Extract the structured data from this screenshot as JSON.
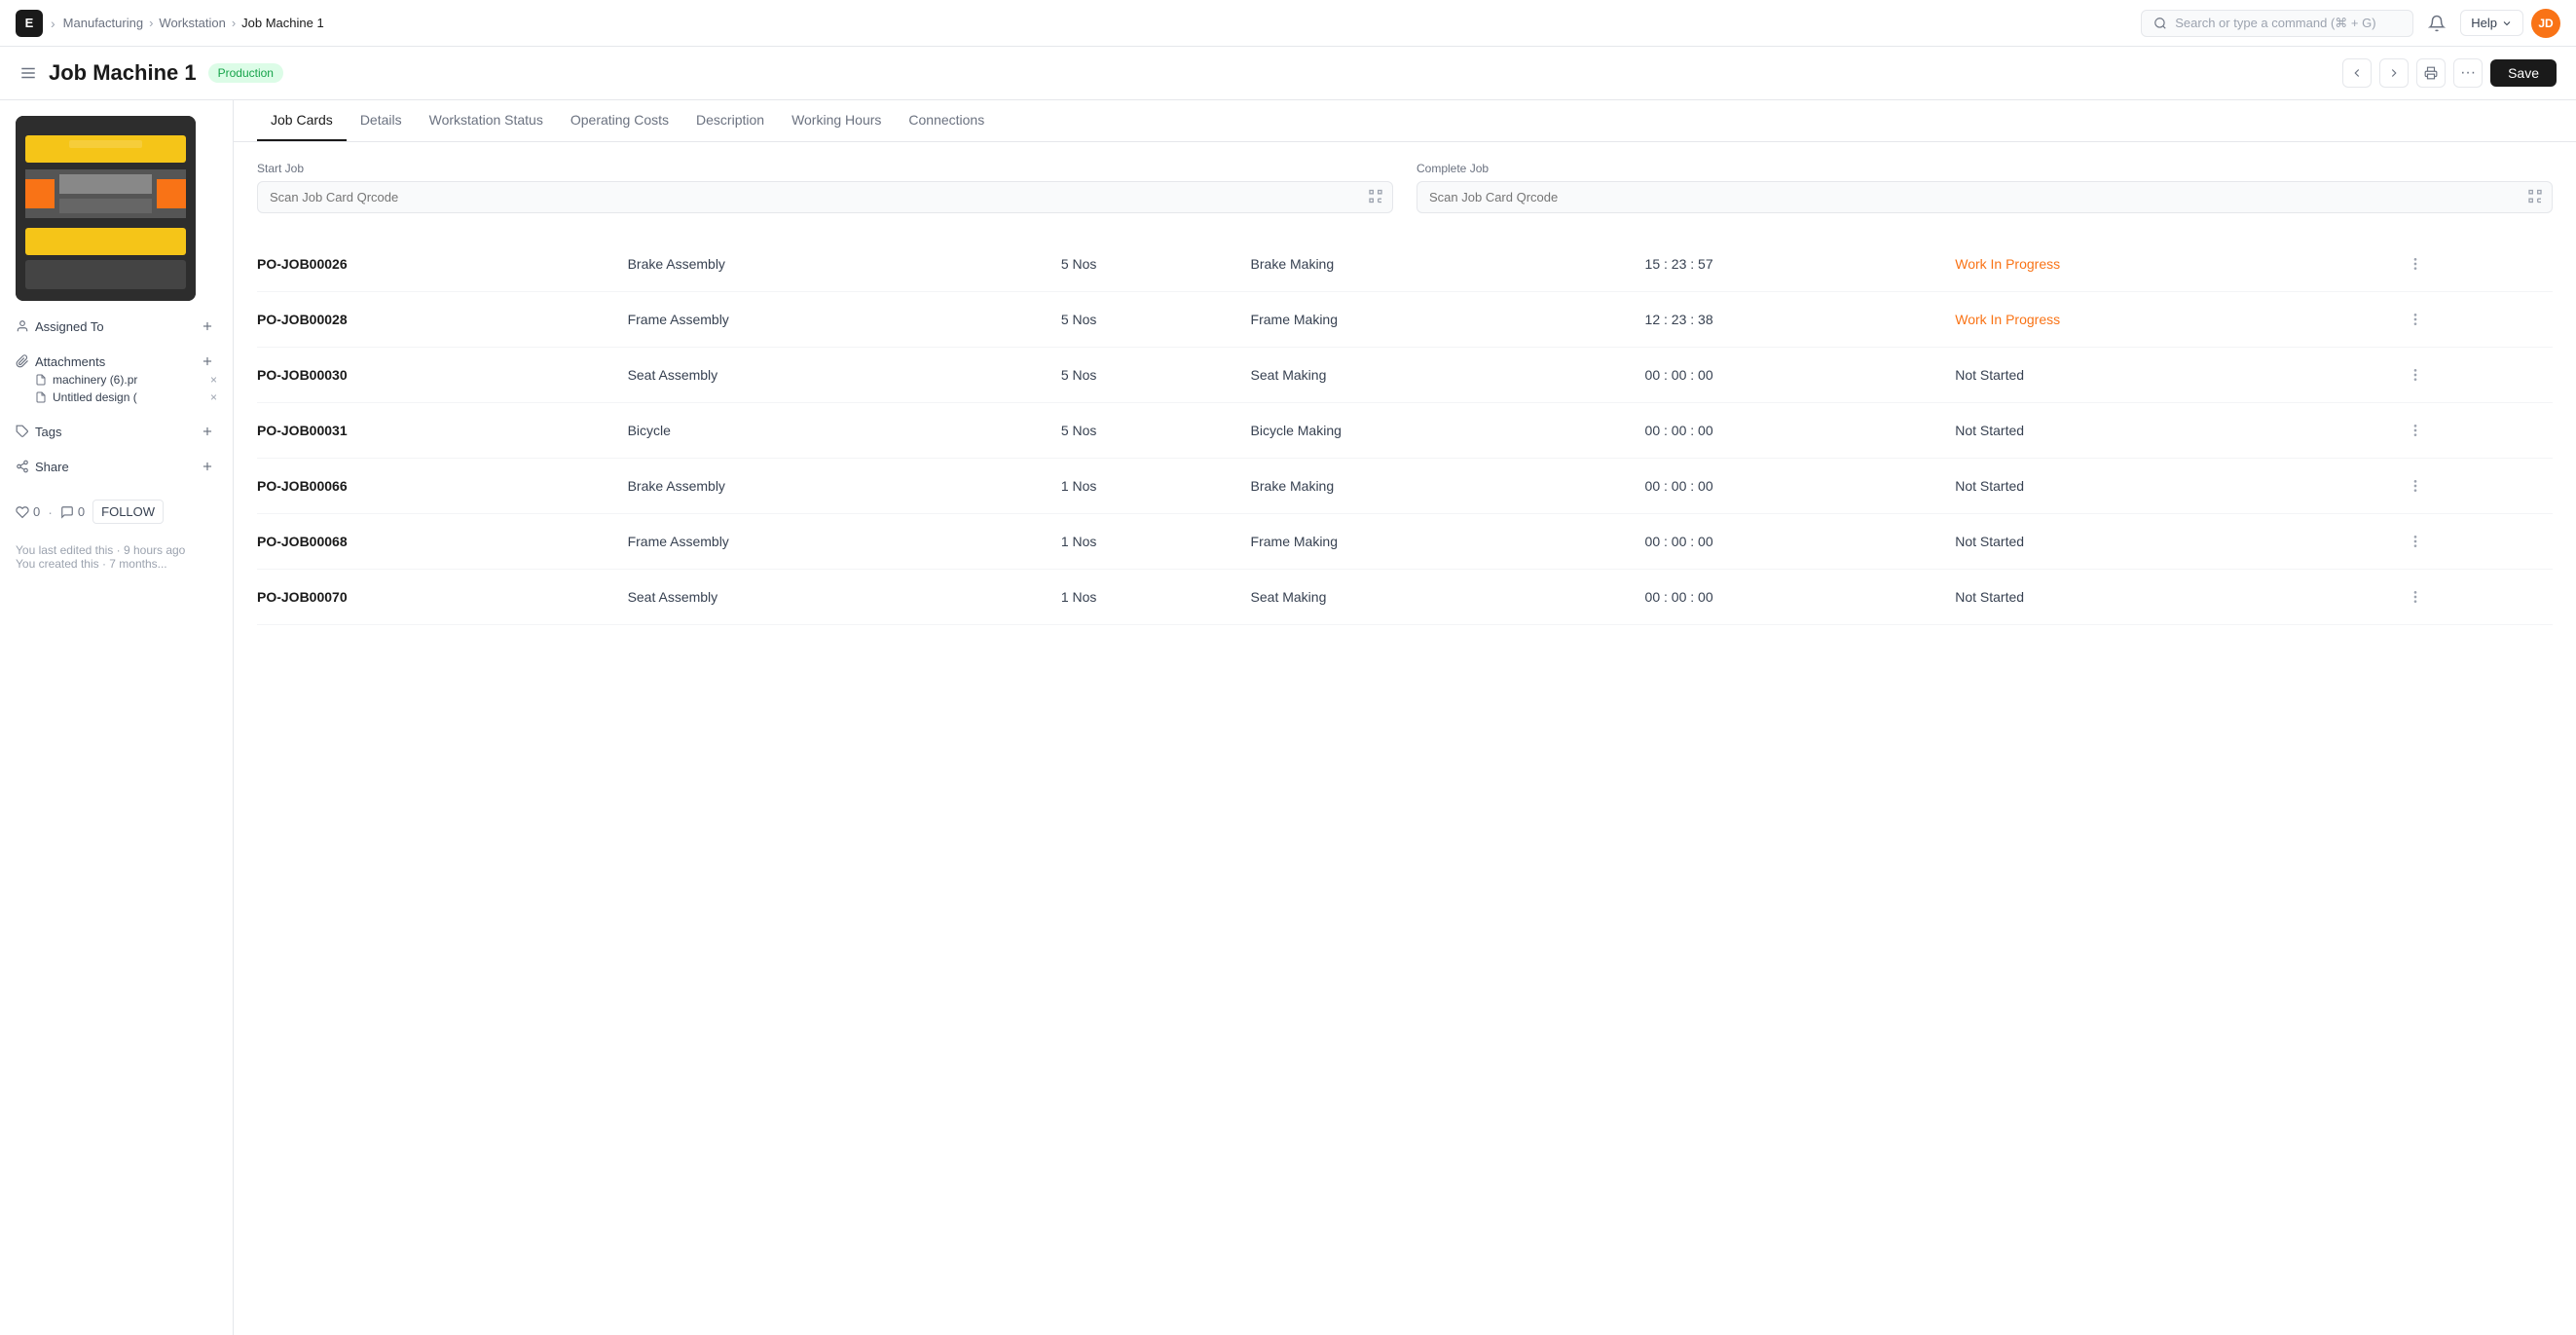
{
  "nav": {
    "logo": "E",
    "breadcrumbs": [
      "Manufacturing",
      "Workstation",
      "Job Machine 1"
    ],
    "search_placeholder": "Search or type a command (⌘ + G)",
    "help_label": "Help",
    "avatar_initials": "JD"
  },
  "header": {
    "title": "Job Machine 1",
    "status": "Production",
    "save_label": "Save"
  },
  "sidebar": {
    "assigned_to_label": "Assigned To",
    "attachments_label": "Attachments",
    "attachment_items": [
      {
        "name": "machinery (6).pr"
      },
      {
        "name": "Untitled design ("
      }
    ],
    "tags_label": "Tags",
    "share_label": "Share",
    "likes_count": "0",
    "comments_count": "0",
    "follow_label": "FOLLOW",
    "last_edited": "You last edited this · 9 hours ago",
    "created_note": "You created this · 7 months..."
  },
  "tabs": [
    {
      "id": "job-cards",
      "label": "Job Cards",
      "active": true
    },
    {
      "id": "details",
      "label": "Details",
      "active": false
    },
    {
      "id": "workstation-status",
      "label": "Workstation Status",
      "active": false
    },
    {
      "id": "operating-costs",
      "label": "Operating Costs",
      "active": false
    },
    {
      "id": "description",
      "label": "Description",
      "active": false
    },
    {
      "id": "working-hours",
      "label": "Working Hours",
      "active": false
    },
    {
      "id": "connections",
      "label": "Connections",
      "active": false
    }
  ],
  "job_cards": {
    "start_job_label": "Start Job",
    "complete_job_label": "Complete Job",
    "scan_placeholder": "Scan Job Card Qrcode",
    "rows": [
      {
        "id": "PO-JOB00026",
        "assembly": "Brake Assembly",
        "qty": "5 Nos",
        "operation": "Brake Making",
        "time": "15 : 23 : 57",
        "status": "Work In Progress",
        "status_type": "wip"
      },
      {
        "id": "PO-JOB00028",
        "assembly": "Frame Assembly",
        "qty": "5 Nos",
        "operation": "Frame Making",
        "time": "12 : 23 : 38",
        "status": "Work In Progress",
        "status_type": "wip"
      },
      {
        "id": "PO-JOB00030",
        "assembly": "Seat Assembly",
        "qty": "5 Nos",
        "operation": "Seat Making",
        "time": "00 : 00 : 00",
        "status": "Not Started",
        "status_type": "not-started"
      },
      {
        "id": "PO-JOB00031",
        "assembly": "Bicycle",
        "qty": "5 Nos",
        "operation": "Bicycle Making",
        "time": "00 : 00 : 00",
        "status": "Not Started",
        "status_type": "not-started"
      },
      {
        "id": "PO-JOB00066",
        "assembly": "Brake Assembly",
        "qty": "1 Nos",
        "operation": "Brake Making",
        "time": "00 : 00 : 00",
        "status": "Not Started",
        "status_type": "not-started"
      },
      {
        "id": "PO-JOB00068",
        "assembly": "Frame Assembly",
        "qty": "1 Nos",
        "operation": "Frame Making",
        "time": "00 : 00 : 00",
        "status": "Not Started",
        "status_type": "not-started"
      },
      {
        "id": "PO-JOB00070",
        "assembly": "Seat Assembly",
        "qty": "1 Nos",
        "operation": "Seat Making",
        "time": "00 : 00 : 00",
        "status": "Not Started",
        "status_type": "not-started"
      }
    ]
  }
}
